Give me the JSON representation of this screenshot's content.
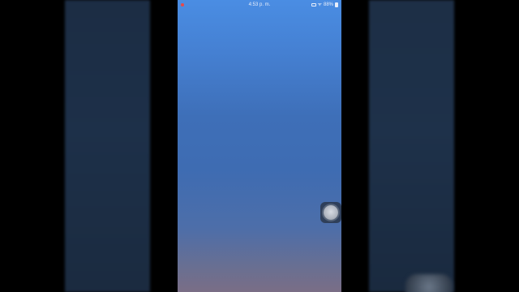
{
  "status_bar": {
    "time": "4:53 p. m.",
    "signal_text": "ᯤ",
    "battery_text": "88%"
  },
  "colors": {
    "indicator": "#e64a4a",
    "screen_top": "#4a8de3",
    "screen_bottom": "#7a6e86"
  },
  "icons": {
    "assistive_touch": "assistive-touch-icon"
  }
}
